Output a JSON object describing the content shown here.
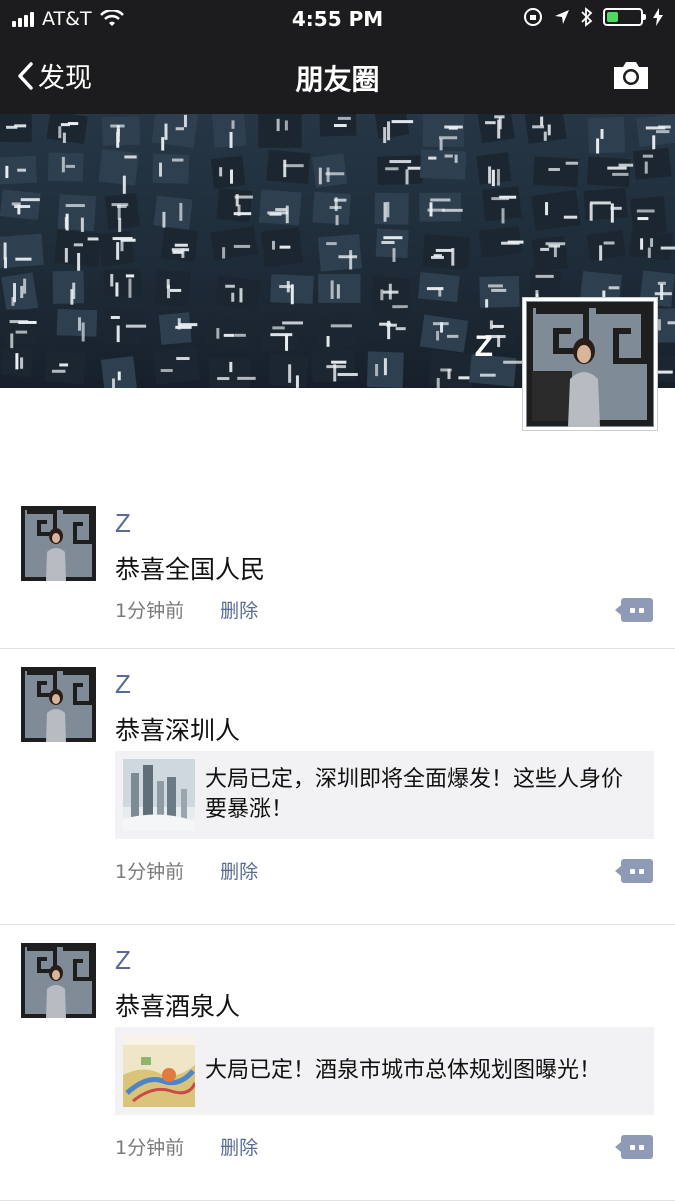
{
  "status_bar": {
    "carrier": "AT&T",
    "time": "4:55 PM",
    "battery_level": 0.35,
    "battery_color": "#4cd964"
  },
  "nav": {
    "back_label": "发现",
    "title": "朋友圈",
    "camera_icon": "camera-icon"
  },
  "cover": {
    "owner_name": "Z"
  },
  "posts": [
    {
      "name": "Z",
      "text": "恭喜全国人民",
      "time": "1分钟前",
      "delete_label": "删除"
    },
    {
      "name": "Z",
      "text": "恭喜深圳人",
      "link_title": "大局已定，深圳即将全面爆发！这些人身价要暴涨！",
      "time": "1分钟前",
      "delete_label": "删除"
    },
    {
      "name": "Z",
      "text": "恭喜酒泉人",
      "link_title": "大局已定！酒泉市城市总体规划图曝光！",
      "time": "1分钟前",
      "delete_label": "删除"
    }
  ],
  "colors": {
    "link_blue": "#576b95",
    "bar_dark": "#1c1c1e",
    "card_bg": "#f2f2f4"
  }
}
